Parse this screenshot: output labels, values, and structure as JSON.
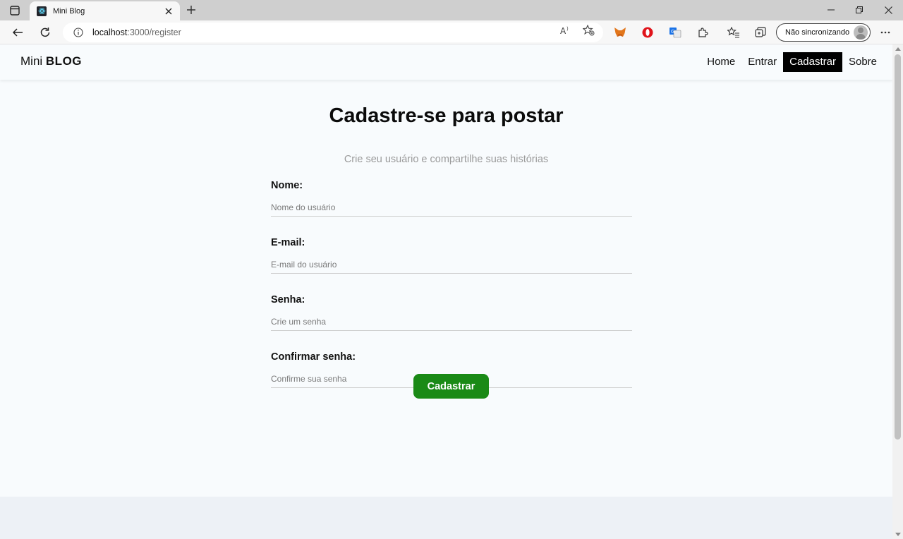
{
  "browser": {
    "tab_title": "Mini Blog",
    "url_host": "localhost",
    "url_path": ":3000/register",
    "sync_label": "Não sincronizando"
  },
  "site": {
    "brand_prefix": "Mini",
    "brand_bold": "BLOG",
    "nav": [
      {
        "label": "Home",
        "active": false
      },
      {
        "label": "Entrar",
        "active": false
      },
      {
        "label": "Cadastrar",
        "active": true
      },
      {
        "label": "Sobre",
        "active": false
      }
    ]
  },
  "page": {
    "title": "Cadastre-se para postar",
    "subtitle": "Crie seu usuário e compartilhe suas histórias",
    "fields": [
      {
        "label": "Nome:",
        "placeholder": "Nome do usuário",
        "value": ""
      },
      {
        "label": "E-mail:",
        "placeholder": "E-mail do usuário",
        "value": ""
      },
      {
        "label": "Senha:",
        "placeholder": "Crie um senha",
        "value": ""
      },
      {
        "label": "Confirmar senha:",
        "placeholder": "Confirme sua senha",
        "value": ""
      }
    ],
    "submit_label": "Cadastrar"
  },
  "colors": {
    "accent_green": "#1a8a16",
    "nav_active_bg": "#000000",
    "page_bg": "#f8fbfd"
  }
}
